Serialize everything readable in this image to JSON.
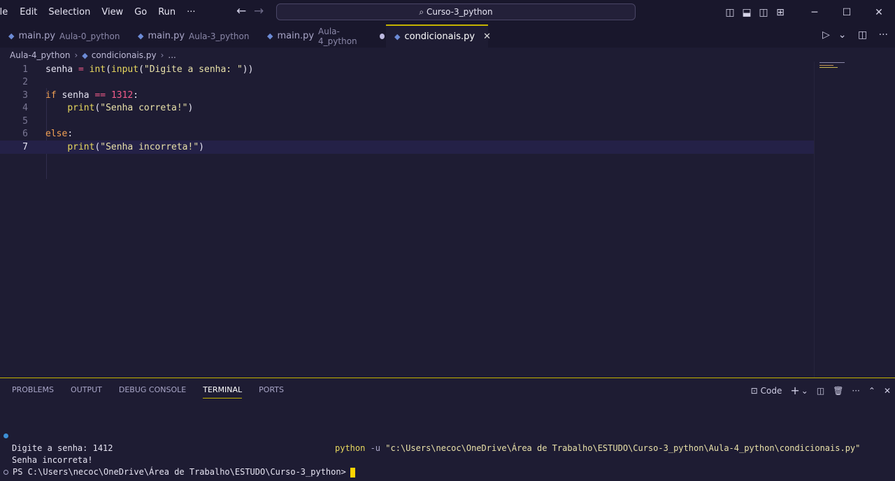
{
  "menu": [
    "ile",
    "Edit",
    "Selection",
    "View",
    "Go",
    "Run",
    "···"
  ],
  "command_center": "Curso-3_python",
  "tabs": [
    {
      "file": "main.py",
      "folder": "Aula-0_python"
    },
    {
      "file": "main.py",
      "folder": "Aula-3_python"
    },
    {
      "file": "main.py",
      "folder": "Aula-4_python"
    },
    {
      "file": "condicionais.py",
      "folder": ""
    }
  ],
  "breadcrumb": {
    "folder": "Aula-4_python",
    "file": "condicionais.py",
    "more": "..."
  },
  "editor": {
    "line_numbers": [
      "1",
      "2",
      "3",
      "4",
      "5",
      "6",
      "7"
    ],
    "l1": {
      "var": "senha",
      "eq": " = ",
      "f1": "int",
      "p1": "(",
      "f2": "input",
      "p2": "(",
      "s": "\"Digite a senha: \"",
      "p3": "))"
    },
    "l3": {
      "kw": "if",
      "var": " senha ",
      "op": "==",
      "sp": " ",
      "num": "1312",
      "colon": ":"
    },
    "l4": {
      "indent": "    ",
      "f": "print",
      "p1": "(",
      "s": "\"Senha correta!\"",
      "p2": ")"
    },
    "l6": {
      "kw": "else",
      "colon": ":"
    },
    "l7": {
      "indent": "    ",
      "f": "print",
      "p1": "(",
      "s": "\"Senha incorreta!\"",
      "p2": ")"
    }
  },
  "panel": {
    "tabs": [
      "PROBLEMS",
      "OUTPUT",
      "DEBUG CONSOLE",
      "TERMINAL",
      "PORTS"
    ],
    "active_tab": "TERMINAL",
    "terminal_label": "Code"
  },
  "terminal": {
    "cmd_python": "python",
    "cmd_flag": " -u ",
    "cmd_path": "\"c:\\Users\\necoc\\OneDrive\\Área de Trabalho\\ESTUDO\\Curso-3_python\\Aula-4_python\\condicionais.py\"",
    "line1": "Digite a senha: 1412",
    "line2": "Senha incorreta!",
    "prompt": "PS C:\\Users\\necoc\\OneDrive\\Área de Trabalho\\ESTUDO\\Curso-3_python>"
  },
  "colors": {
    "accent": "#c4b300",
    "background": "#1e1c33"
  }
}
